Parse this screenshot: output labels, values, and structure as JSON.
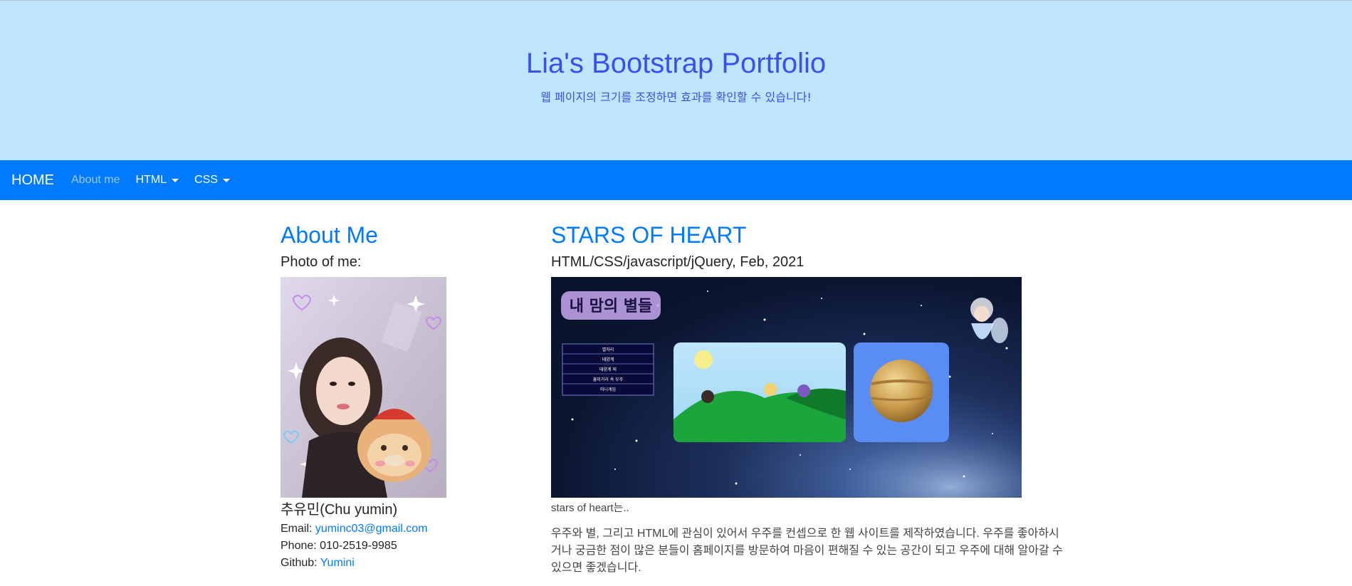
{
  "jumbotron": {
    "title": "Lia's Bootstrap Portfolio",
    "subtitle": "웹 페이지의 크기를 조정하면 효과를 확인할 수 있습니다!"
  },
  "navbar": {
    "brand": "HOME",
    "links": [
      {
        "label": "About me"
      },
      {
        "label": "HTML"
      },
      {
        "label": "CSS"
      }
    ]
  },
  "about": {
    "title": "About Me",
    "photo_label": "Photo of me:",
    "name": "추유민(Chu yumin)",
    "email_label": "Email:",
    "email": "yuminc03@gmail.com",
    "phone_label": "Phone:",
    "phone": "010-2519-9985",
    "github_label": "Github:",
    "github": "Yumini"
  },
  "project": {
    "title": "STARS OF HEART",
    "subtitle": "HTML/CSS/javascript/jQuery, Feb, 2021",
    "image_title": "내 맘의 별들",
    "image_menu": [
      "별자리",
      "태양계",
      "태양계 외",
      "흥미거리 속 우주",
      "미니게임"
    ],
    "caption": "stars of heart는..",
    "description": "우주와 별, 그리고 HTML에 관심이 있어서 우주를 컨셉으로 한 웹 사이트를 제작하였습니다. 우주를 좋아하시거나 궁금한 점이 많은 분들이 홈페이지를 방문하여 마음이 편해질 수 있는 공간이 되고 우주에 대해 알아갈 수 있으면 좋겠습니다."
  },
  "colors": {
    "jumbotron_bg": "#bee5fb",
    "navbar_bg": "#007bff",
    "accent": "#007bff",
    "title_blue": "#3b4ff0"
  }
}
